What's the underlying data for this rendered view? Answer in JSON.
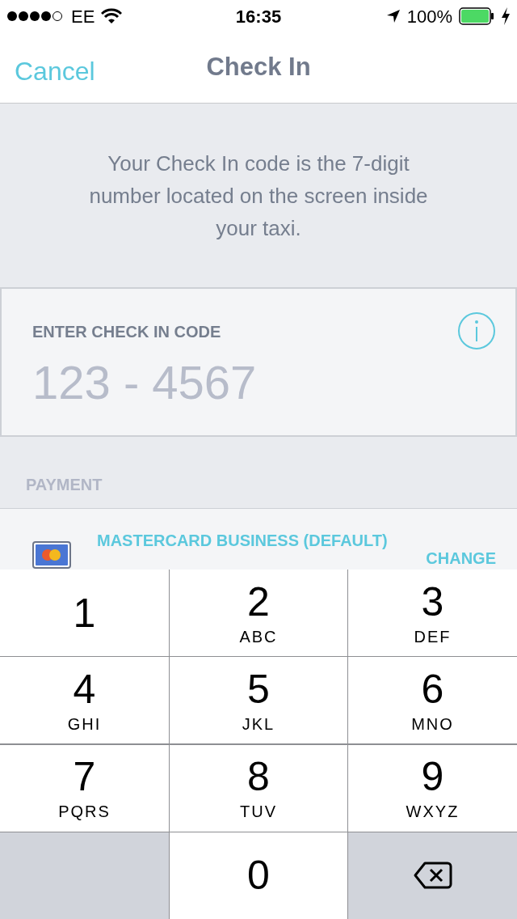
{
  "status_bar": {
    "carrier": "EE",
    "time": "16:35",
    "battery": "100%"
  },
  "nav": {
    "cancel": "Cancel",
    "title": "Check In"
  },
  "intro": "Your Check In code is the 7-digit number located on the screen inside your taxi.",
  "code_field": {
    "label": "ENTER CHECK IN CODE",
    "placeholder": "123 - 4567"
  },
  "payment": {
    "heading": "PAYMENT",
    "card_name": "MASTERCARD BUSINESS (DEFAULT)",
    "change": "CHANGE"
  },
  "keypad": [
    {
      "kind": "digit",
      "digit": "1"
    },
    {
      "kind": "digit",
      "digit": "2",
      "letters": "ABC"
    },
    {
      "kind": "digit",
      "digit": "3",
      "letters": "DEF"
    },
    {
      "kind": "digit",
      "digit": "4",
      "letters": "GHI"
    },
    {
      "kind": "digit",
      "digit": "5",
      "letters": "JKL"
    },
    {
      "kind": "digit",
      "digit": "6",
      "letters": "MNO"
    },
    {
      "kind": "digit",
      "digit": "7",
      "letters": "PQRS"
    },
    {
      "kind": "digit",
      "digit": "8",
      "letters": "TUV"
    },
    {
      "kind": "digit",
      "digit": "9",
      "letters": "WXYZ"
    },
    {
      "kind": "blank"
    },
    {
      "kind": "digit",
      "digit": "0"
    },
    {
      "kind": "delete"
    }
  ]
}
